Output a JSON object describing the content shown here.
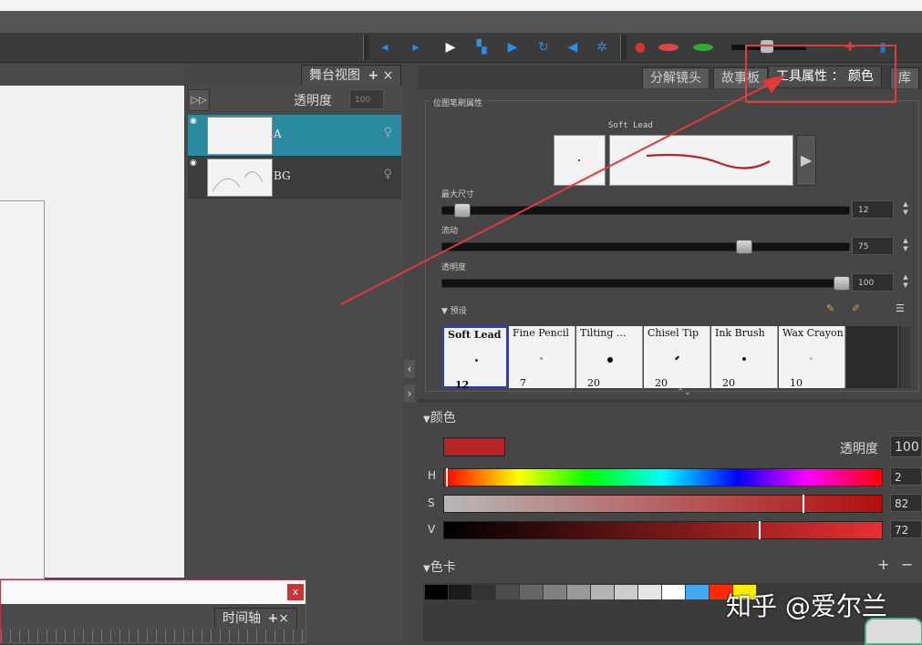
{
  "stage_panel": {
    "tab_label": "舞台视图",
    "add_icon": "+",
    "close_icon": "×"
  },
  "layers": {
    "opacity_label": "透明度",
    "opacity_value": "100",
    "items": [
      {
        "name": "A",
        "selected": true
      },
      {
        "name": "BG",
        "selected": false
      }
    ]
  },
  "timeline": {
    "tab_label": "时间轴",
    "close_label": "x"
  },
  "right_tabs": [
    {
      "label": "分解镜头"
    },
    {
      "label": "故事板"
    },
    {
      "label": "工具属性 ： 颜色"
    },
    {
      "label": "库"
    }
  ],
  "brush": {
    "group_title": "位图笔刷属性",
    "current_brush_name": "Soft Lead",
    "max_size": {
      "label": "最大尺寸",
      "value": "12",
      "fraction": 0.05
    },
    "flow": {
      "label": "流动",
      "value": "75",
      "fraction": 0.75
    },
    "opacity": {
      "label": "透明度",
      "value": "100",
      "fraction": 1.0
    },
    "presets_title": "预设",
    "presets": [
      {
        "name": "Soft Lead",
        "size": "12",
        "selected": true
      },
      {
        "name": "Fine Pencil",
        "size": "7",
        "selected": false
      },
      {
        "name": "Tilting ...",
        "size": "20",
        "selected": false
      },
      {
        "name": "Chisel Tip",
        "size": "20",
        "selected": false
      },
      {
        "name": "Ink Brush",
        "size": "20",
        "selected": false
      },
      {
        "name": "Wax Crayon",
        "size": "10",
        "selected": false
      }
    ]
  },
  "color": {
    "section_title": "颜色",
    "current_color": "#b52525",
    "opacity_label": "透明度",
    "opacity_value": "100",
    "h": {
      "label": "H",
      "value": "2",
      "fraction": 0.005
    },
    "s": {
      "label": "S",
      "value": "82",
      "fraction": 0.82
    },
    "v": {
      "label": "V",
      "value": "72",
      "fraction": 0.72
    }
  },
  "palette": {
    "section_title": "色卡",
    "add_icon": "+",
    "remove_icon": "−",
    "swatches": [
      "#000000",
      "#1a1a1a",
      "#333333",
      "#4d4d4d",
      "#666666",
      "#808080",
      "#999999",
      "#b3b3b3",
      "#cccccc",
      "#e6e6e6",
      "#ffffff",
      "#3fa9f5",
      "#ff2a00",
      "#ffee00"
    ]
  },
  "watermark": "知乎 @爱尔兰",
  "annotation": {
    "color": "#e03a3a"
  }
}
